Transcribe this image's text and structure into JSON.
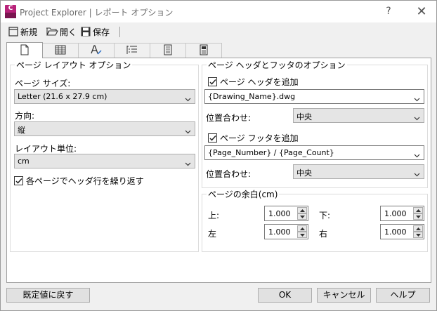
{
  "window": {
    "app_icon_letter": "C",
    "title": "Project Explorer | レポート オプション",
    "help_glyph": "?",
    "close_glyph": "✕"
  },
  "toolbar": {
    "new_label": "新規",
    "open_label": "開く",
    "save_label": "保存"
  },
  "tabs": [
    {
      "icon": "page-icon",
      "active": true
    },
    {
      "icon": "table-icon",
      "active": false
    },
    {
      "icon": "text-style-icon",
      "active": false
    },
    {
      "icon": "outline-list-icon",
      "active": false
    },
    {
      "icon": "document-icon",
      "active": false
    },
    {
      "icon": "document-list-icon",
      "active": false
    }
  ],
  "layout": {
    "group_title": "ページ レイアウト オプション",
    "page_size_label": "ページ サイズ:",
    "page_size_value": "Letter (21.6 x 27.9 cm)",
    "orientation_label": "方向:",
    "orientation_value": "縦",
    "unit_label": "レイアウト単位:",
    "unit_value": "cm",
    "repeat_header_label": "各ページでヘッダ行を繰り返す",
    "repeat_header_checked": true
  },
  "header_footer": {
    "group_title": "ページ ヘッダとフッタのオプション",
    "add_header_label": "ページ ヘッダを追加",
    "add_header_checked": true,
    "header_value": "{Drawing_Name}.dwg",
    "header_align_label": "位置合わせ:",
    "header_align_value": "中央",
    "add_footer_label": "ページ フッタを追加",
    "add_footer_checked": true,
    "footer_value": "{Page_Number} / {Page_Count}",
    "footer_align_label": "位置合わせ:",
    "footer_align_value": "中央"
  },
  "margins": {
    "group_title": "ページの余白(cm)",
    "top_label": "上:",
    "top_value": "1.000",
    "bottom_label": "下:",
    "bottom_value": "1.000",
    "left_label": "左",
    "left_value": "1.000",
    "right_label": "右",
    "right_value": "1.000"
  },
  "buttons": {
    "reset_label": "既定値に戻す",
    "ok_label": "OK",
    "cancel_label": "キャンセル",
    "help_label": "ヘルプ"
  }
}
